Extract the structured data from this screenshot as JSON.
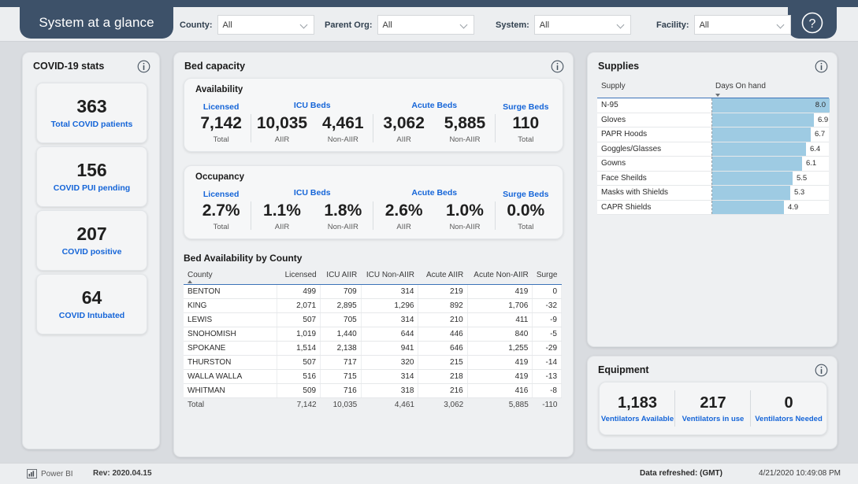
{
  "app": {
    "title": "System at a glance",
    "help_icon": "question-mark-circle-icon"
  },
  "filters": [
    {
      "label": "County:",
      "value": "All"
    },
    {
      "label": "Parent Org:",
      "value": "All"
    },
    {
      "label": "System:",
      "value": "All"
    },
    {
      "label": "Facility:",
      "value": "All"
    }
  ],
  "covid_stats": {
    "title": "COVID-19 stats",
    "cards": [
      {
        "value": "363",
        "label": "Total COVID patients"
      },
      {
        "value": "156",
        "label": "COVID PUI pending"
      },
      {
        "value": "207",
        "label": "COVID positive"
      },
      {
        "value": "64",
        "label": "COVID Intubated"
      }
    ]
  },
  "bed_capacity": {
    "title": "Bed capacity",
    "availability": {
      "title": "Availability",
      "groups": [
        {
          "name": "Licensed",
          "span": 1
        },
        {
          "name": "ICU Beds",
          "span": 2
        },
        {
          "name": "Acute Beds",
          "span": 2
        },
        {
          "name": "Surge Beds",
          "span": 1
        }
      ],
      "metrics": [
        {
          "value": "7,142",
          "sub": "Total"
        },
        {
          "value": "10,035",
          "sub": "AIIR"
        },
        {
          "value": "4,461",
          "sub": "Non-AIIR"
        },
        {
          "value": "3,062",
          "sub": "AIIR"
        },
        {
          "value": "5,885",
          "sub": "Non-AIIR"
        },
        {
          "value": "110",
          "sub": "Total"
        }
      ]
    },
    "occupancy": {
      "title": "Occupancy",
      "groups": [
        {
          "name": "Licensed",
          "span": 1
        },
        {
          "name": "ICU Beds",
          "span": 2
        },
        {
          "name": "Acute Beds",
          "span": 2
        },
        {
          "name": "Surge Beds",
          "span": 1
        }
      ],
      "metrics": [
        {
          "value": "2.7%",
          "sub": "Total"
        },
        {
          "value": "1.1%",
          "sub": "AIIR"
        },
        {
          "value": "1.8%",
          "sub": "Non-AIIR"
        },
        {
          "value": "2.6%",
          "sub": "AIIR"
        },
        {
          "value": "1.0%",
          "sub": "Non-AIIR"
        },
        {
          "value": "0.0%",
          "sub": "Total"
        }
      ]
    },
    "county_table": {
      "title": "Bed Availability by County",
      "columns": [
        "County",
        "Licensed",
        "ICU AIIR",
        "ICU Non-AIIR",
        "Acute AIIR",
        "Acute Non-AIIR",
        "Surge"
      ],
      "rows": [
        [
          "BENTON",
          "499",
          "709",
          "314",
          "219",
          "419",
          "0"
        ],
        [
          "KING",
          "2,071",
          "2,895",
          "1,296",
          "892",
          "1,706",
          "-32"
        ],
        [
          "LEWIS",
          "507",
          "705",
          "314",
          "210",
          "411",
          "-9"
        ],
        [
          "SNOHOMISH",
          "1,019",
          "1,440",
          "644",
          "446",
          "840",
          "-5"
        ],
        [
          "SPOKANE",
          "1,514",
          "2,138",
          "941",
          "646",
          "1,255",
          "-29"
        ],
        [
          "THURSTON",
          "507",
          "717",
          "320",
          "215",
          "419",
          "-14"
        ],
        [
          "WALLA WALLA",
          "516",
          "715",
          "314",
          "218",
          "419",
          "-13"
        ],
        [
          "WHITMAN",
          "509",
          "716",
          "318",
          "216",
          "416",
          "-8"
        ]
      ],
      "total_row": [
        "Total",
        "7,142",
        "10,035",
        "4,461",
        "3,062",
        "5,885",
        "-110"
      ]
    }
  },
  "supplies": {
    "title": "Supplies",
    "columns": [
      "Supply",
      "Days On hand"
    ],
    "bar_color": "#9ecbe3",
    "rows": [
      {
        "name": "N-95",
        "value": "8.0",
        "num": 8.0
      },
      {
        "name": "Gloves",
        "value": "6.9",
        "num": 6.9
      },
      {
        "name": "PAPR Hoods",
        "value": "6.7",
        "num": 6.7
      },
      {
        "name": "Goggles/Glasses",
        "value": "6.4",
        "num": 6.4
      },
      {
        "name": "Gowns",
        "value": "6.1",
        "num": 6.1
      },
      {
        "name": "Face Sheilds",
        "value": "5.5",
        "num": 5.5
      },
      {
        "name": "Masks with Shields",
        "value": "5.3",
        "num": 5.3
      },
      {
        "name": "CAPR Shields",
        "value": "4.9",
        "num": 4.9
      }
    ]
  },
  "equipment": {
    "title": "Equipment",
    "cells": [
      {
        "value": "1,183",
        "label": "Ventilators Available"
      },
      {
        "value": "217",
        "label": "Ventilators in use"
      },
      {
        "value": "0",
        "label": "Ventilators Needed"
      }
    ]
  },
  "footer": {
    "powerbi": "Power BI",
    "revision": "Rev: 2020.04.15",
    "refreshed_label": "Data refreshed: (GMT)",
    "refreshed_time": "4/21/2020 10:49:08 PM"
  },
  "chart_data": {
    "type": "bar",
    "title": "Supplies",
    "xlabel": "Days On hand",
    "ylabel": "Supply",
    "orientation": "horizontal",
    "categories": [
      "N-95",
      "Gloves",
      "PAPR Hoods",
      "Goggles/Glasses",
      "Gowns",
      "Face Sheilds",
      "Masks with Shields",
      "CAPR Shields"
    ],
    "values": [
      8.0,
      6.9,
      6.7,
      6.4,
      6.1,
      5.5,
      5.3,
      4.9
    ],
    "xlim": [
      0,
      8.0
    ],
    "grid": false,
    "legend": "none"
  }
}
